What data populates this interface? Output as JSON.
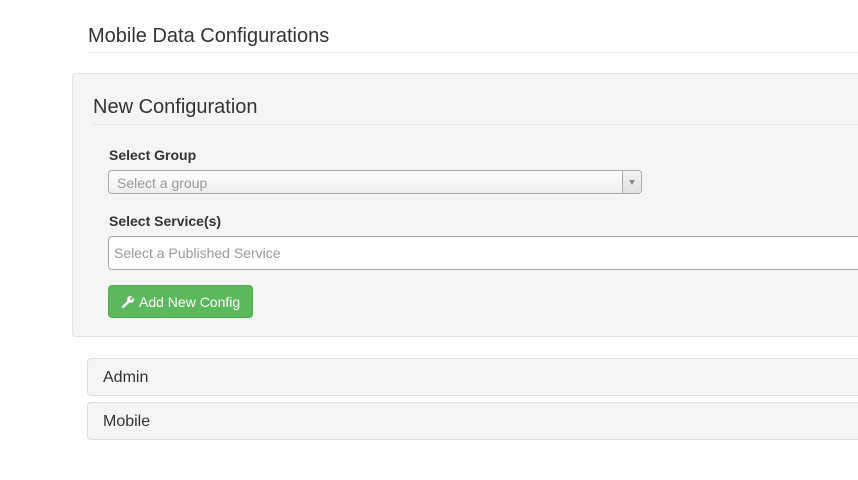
{
  "header": {
    "title": "Mobile Data Configurations"
  },
  "new_config": {
    "title": "New Configuration",
    "group_label": "Select Group",
    "group_placeholder": "Select a group",
    "service_label": "Select Service(s)",
    "service_placeholder": "Select a Published Service",
    "add_button_label": "Add New Config",
    "add_button_icon": "wrench-icon",
    "add_button_color": "#5cb85c"
  },
  "sections": [
    {
      "label": "Admin"
    },
    {
      "label": "Mobile"
    }
  ]
}
